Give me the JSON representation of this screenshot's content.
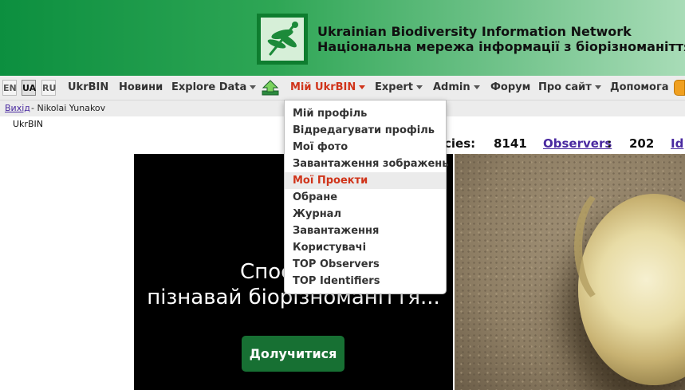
{
  "header": {
    "title_en": "Ukrainian Biodiversity Information Network",
    "title_ua": "Національна мережа інформації з біорізноманіття",
    "logo_icon": "dragonfly-icon"
  },
  "languages": [
    "EN",
    "UA",
    "RU"
  ],
  "nav": {
    "ukrbin": "UkrBIN",
    "news": "Новини",
    "explore": "Explore Data",
    "upload_icon": "upload-arrow-icon",
    "my_ukrbin": "Мій UkrBIN",
    "expert": "Expert",
    "admin": "Admin",
    "forum": "Форум",
    "about": "Про сайт",
    "help": "Допомога"
  },
  "subbar": {
    "logout": "Вихід",
    "user": " - Nikolai Yunakov"
  },
  "breadcrumb": "UkrBIN",
  "stats": {
    "species_label": "cies:",
    "species_value": "8141",
    "observers_label": "Observers",
    "observers_colon": ":",
    "observers_value": "202",
    "next_label": "Id"
  },
  "hero": {
    "line1": "Спостеріг",
    "line2": "пізнавай біорізноманіття...",
    "join_button": "Долучитися"
  },
  "dropdown": {
    "items": [
      "Мій профіль",
      "Відредагувати профіль",
      "Мої фото",
      "Завантаження зображень",
      "Мої Проекти",
      "Обране",
      "Журнал",
      "Завантаження",
      "Користувачі",
      "TOP Observers",
      "TOP Identifiers"
    ],
    "active_index": 4
  },
  "colors": {
    "accent_red": "#d0341a",
    "brand_green": "#177033",
    "link_purple": "#4a2aa0"
  }
}
